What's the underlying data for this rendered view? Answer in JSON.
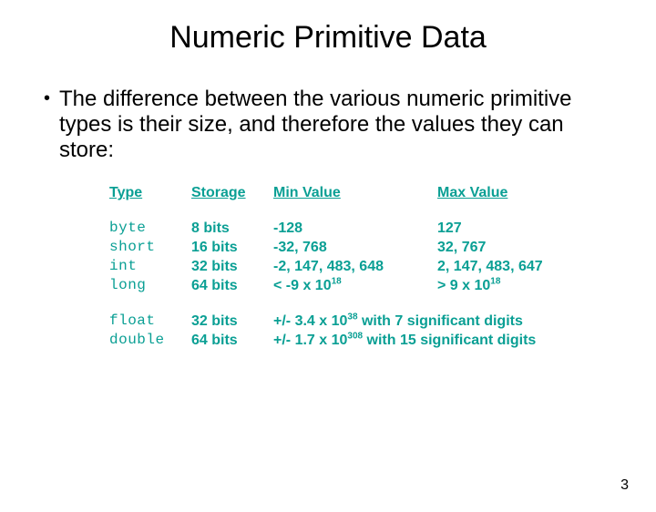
{
  "title": "Numeric Primitive Data",
  "bullet": "The difference between the various numeric primitive types is their size, and therefore the values they can store:",
  "headers": {
    "type": "Type",
    "storage": "Storage",
    "min": "Min Value",
    "max": "Max Value"
  },
  "int_rows": [
    {
      "type": "byte",
      "storage": "8 bits",
      "min": "-128",
      "max": "127"
    },
    {
      "type": "short",
      "storage": "16 bits",
      "min": "-32, 768",
      "max": "32, 767"
    },
    {
      "type": "int",
      "storage": "32 bits",
      "min": "-2, 147, 483, 648",
      "max": "2, 147, 483, 647"
    },
    {
      "type": "long",
      "storage": "64 bits",
      "min_pre": "< -9 x 10",
      "min_exp": "18",
      "max_pre": "> 9 x 10",
      "max_exp": "18"
    }
  ],
  "float_rows": [
    {
      "type": "float",
      "storage": "32 bits",
      "desc_pre": "+/- 3.4 x 10",
      "desc_exp": "38",
      "desc_post": " with 7 significant digits"
    },
    {
      "type": "double",
      "storage": "64 bits",
      "desc_pre": "+/- 1.7 x 10",
      "desc_exp": "308",
      "desc_post": " with 15 significant digits"
    }
  ],
  "page_number": "3"
}
